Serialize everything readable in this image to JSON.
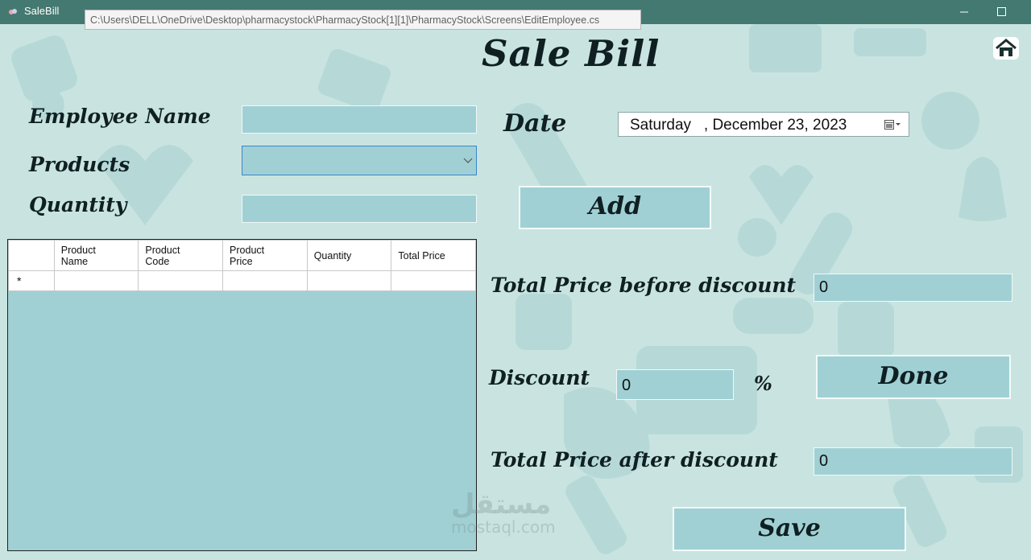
{
  "window": {
    "title": "SaleBill",
    "path_tooltip": "C:\\Users\\DELL\\OneDrive\\Desktop\\pharmacystock\\PharmacyStock[1][1]\\PharmacyStock\\Screens\\EditEmployee.cs"
  },
  "heading": "Sale Bill",
  "labels": {
    "employee_name": "Employee Name",
    "products": "Products",
    "quantity": "Quantity",
    "date": "Date",
    "total_before": "Total Price before discount",
    "discount": "Discount",
    "percent": "%",
    "total_after": "Total Price after discount"
  },
  "fields": {
    "employee_name": "",
    "products_selected": "",
    "quantity": "",
    "total_before": "0",
    "discount": "0",
    "total_after": "0"
  },
  "date": {
    "day": "Saturday",
    "date": ", December 23, 2023"
  },
  "buttons": {
    "add": "Add",
    "done": "Done",
    "save": "Save"
  },
  "grid": {
    "columns": [
      {
        "line1": "Product",
        "line2": "Name"
      },
      {
        "line1": "Product",
        "line2": "Code"
      },
      {
        "line1": "Product",
        "line2": "Price"
      },
      {
        "line1": "Quantity",
        "line2": ""
      },
      {
        "line1": "Total Price",
        "line2": ""
      }
    ],
    "new_row_marker": "*"
  },
  "watermark": {
    "arabic": "مستقل",
    "latin": "mostaql.com"
  },
  "colors": {
    "titlebar": "#437970",
    "background": "#c9e4e0",
    "field": "#a0d0d4"
  }
}
